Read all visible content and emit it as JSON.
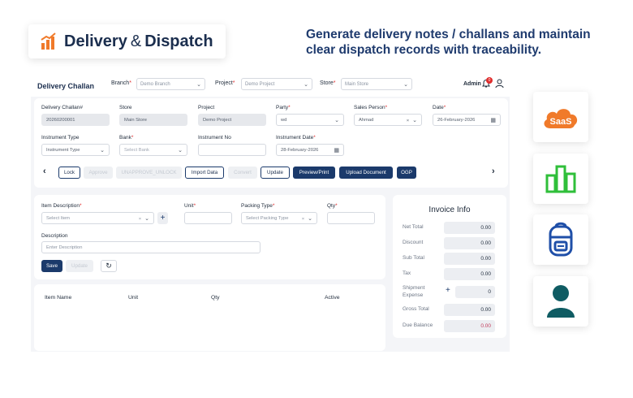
{
  "hero": {
    "title_main": "Delivery",
    "title_amp": "&",
    "title_end": "Dispatch",
    "tagline_line1": "Generate delivery notes / challans and maintain",
    "tagline_line2": "clear dispatch records with traceability."
  },
  "topbar": {
    "title": "Delivery Challan",
    "branch_label": "Branch",
    "branch_value": "Demo Branch",
    "project_label": "Project",
    "project_value": "Demo Project",
    "store_label": "Store",
    "store_value": "Main Store",
    "user": "Admin",
    "notif_count": "0"
  },
  "form": {
    "challan_no_label": "Delivery Challan#",
    "challan_no_value": "20260200001",
    "store_label": "Store",
    "store_value": "Main Store",
    "project_label": "Project",
    "project_value": "Demo Project",
    "party_label": "Party",
    "party_value": "wd",
    "sales_label": "Sales Person",
    "sales_value": "Ahmad",
    "date_label": "Date",
    "date_value": "26-February-2026",
    "inst_type_label": "Instrument Type",
    "inst_type_placeholder": "Instrument Type",
    "bank_label": "Bank",
    "bank_placeholder": "Select Bank",
    "inst_no_label": "Instrument No",
    "inst_date_label": "Instrument Date",
    "inst_date_value": "28-February-2026"
  },
  "actions": {
    "lock": "Lock",
    "approve": "Approve",
    "unapprove": "UNAPPROVE_UNLOCK",
    "import": "Import Data",
    "convert": "Convert",
    "update": "Update",
    "preview": "Preview/Print",
    "upload": "Upload Document",
    "ogp": "OGP"
  },
  "item": {
    "desc_label": "Item Description",
    "desc_placeholder": "Select Item",
    "unit_label": "Unit",
    "packing_label": "Packing Type",
    "packing_placeholder": "Select Packing Type",
    "qty_label": "Qty",
    "description_label": "Description",
    "description_placeholder": "Enter Description",
    "save": "Save",
    "update": "Update"
  },
  "invoice": {
    "title": "Invoice Info",
    "net_label": "Net Total",
    "net": "0.00",
    "discount_label": "Discount",
    "discount": "0.00",
    "sub_label": "Sub Total",
    "sub": "0.00",
    "tax_label": "Tax",
    "tax": "0.00",
    "ship_label1": "Shipment",
    "ship_label2": "Expense",
    "ship": "0",
    "gross_label": "Gross Total",
    "gross": "0.00",
    "due_label": "Due Balance",
    "due": "0.00"
  },
  "table": {
    "col_item": "Item Name",
    "col_unit": "Unit",
    "col_qty": "Qty",
    "col_active": "Active"
  },
  "side": {
    "saas": "SaaS"
  },
  "colors": {
    "navy": "#1b3a6b",
    "orange": "#f07a2a",
    "green": "#2fbf3a",
    "blue": "#1f4fa8",
    "teal": "#0f5c63"
  }
}
